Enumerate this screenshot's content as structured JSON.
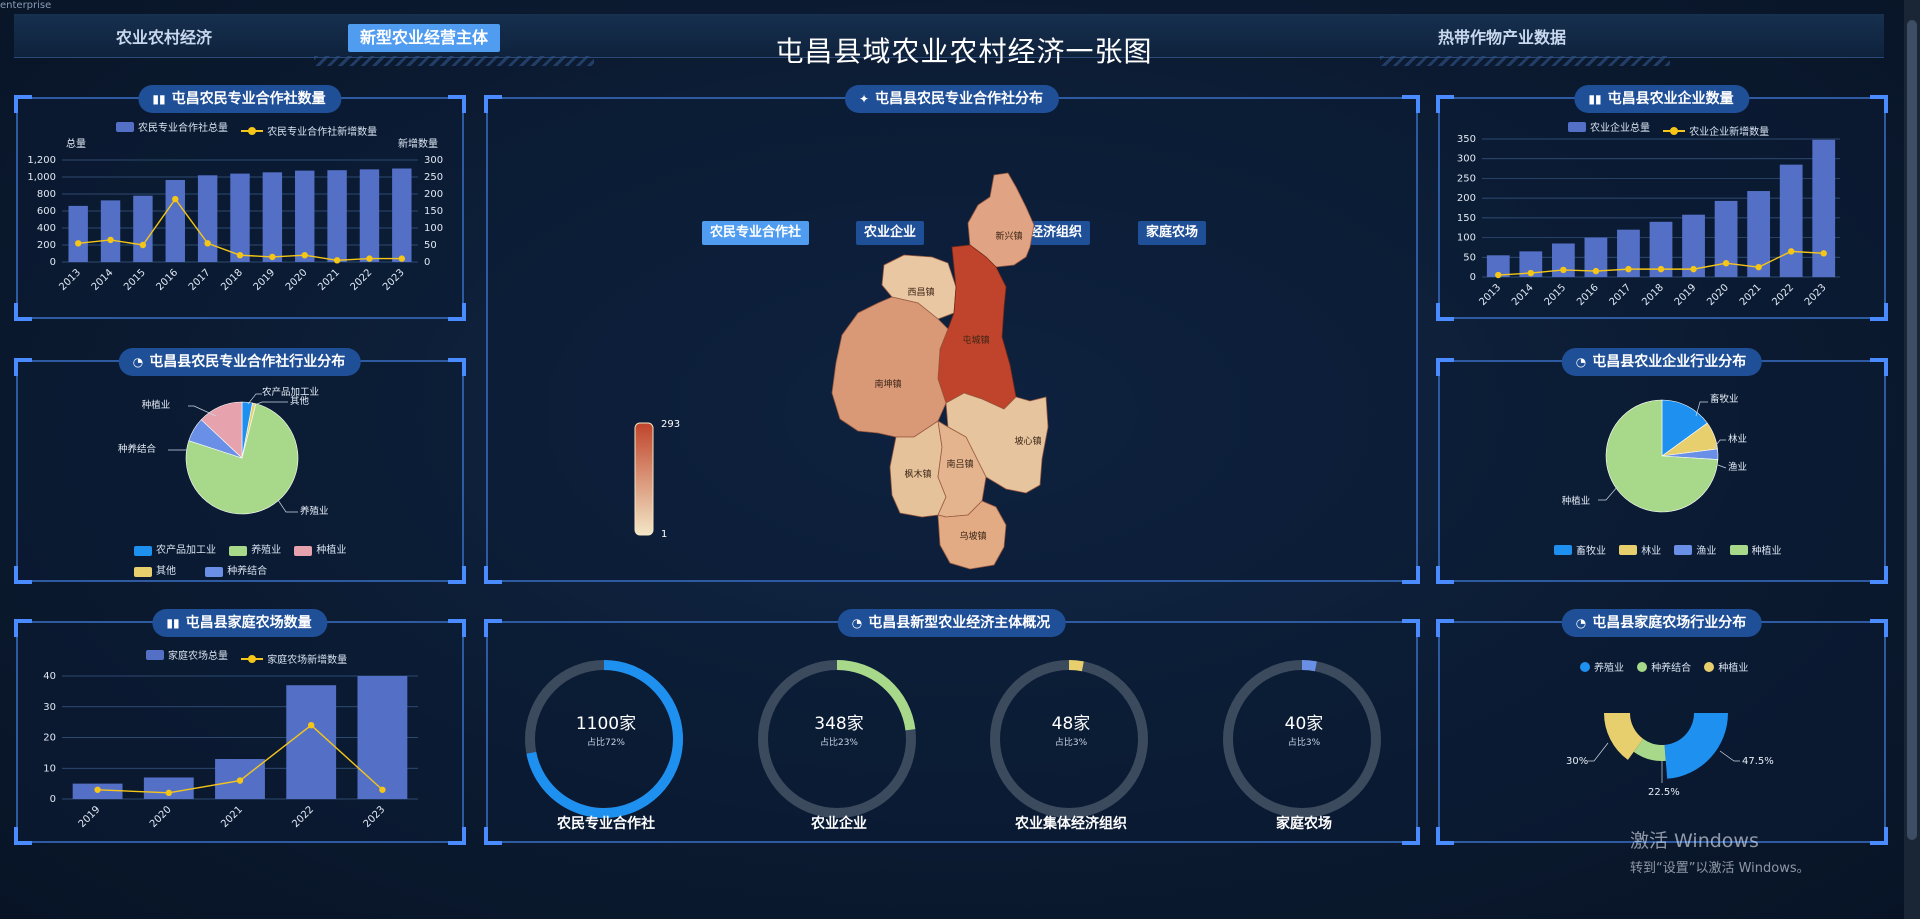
{
  "corner_text": "enterprise",
  "header": {
    "tabs": [
      {
        "label": "农业农村经济",
        "active": false
      },
      {
        "label": "新型农业经营主体",
        "active": true
      },
      {
        "label": "热带作物产业数据",
        "active": false
      }
    ],
    "title": "屯昌县域农业农村经济一张图"
  },
  "coop_count": {
    "title": "屯昌农民专业合作社数量",
    "legend_total": "农民专业合作社总量",
    "legend_new": "农民专业合作社新增数量",
    "ylabel_left": "总量",
    "ylabel_right": "新增数量",
    "left_ticks": [
      "1,200",
      "1,000",
      "800",
      "600",
      "400",
      "200",
      "0"
    ],
    "right_ticks": [
      "300",
      "250",
      "200",
      "150",
      "100",
      "50",
      "0"
    ]
  },
  "coop_industry": {
    "title": "屯昌县农民专业合作社行业分布",
    "labels": {
      "processing": "农产品加工业",
      "other": "其他",
      "planting": "种植业",
      "combo": "种养结合",
      "breeding": "养殖业"
    },
    "legend": [
      "农产品加工业",
      "养殖业",
      "种植业",
      "其他",
      "种养结合"
    ]
  },
  "family_farm_count": {
    "title": "屯昌县家庭农场数量",
    "legend_total": "家庭农场总量",
    "legend_new": "家庭农场新增数量",
    "ticks": [
      "40",
      "30",
      "20",
      "10",
      "0"
    ]
  },
  "map": {
    "title": "屯昌县农民专业合作社分布",
    "tabs": [
      {
        "label": "农民专业合作社",
        "active": true
      },
      {
        "label": "农业企业",
        "active": false
      },
      {
        "label": "农村集体经济组织",
        "active": false
      },
      {
        "label": "家庭农场",
        "active": false
      }
    ],
    "scale_max": "293",
    "scale_min": "1",
    "towns": [
      "新兴镇",
      "西昌镇",
      "屯城镇",
      "南坤镇",
      "坡心镇",
      "枫木镇",
      "南吕镇",
      "乌坡镇"
    ]
  },
  "overview": {
    "title": "屯昌县新型农业经济主体概况",
    "rings": [
      {
        "value": "1100家",
        "ratio": "占比72%",
        "name": "农民专业合作社",
        "pct": 72,
        "color": "#1e90f0"
      },
      {
        "value": "348家",
        "ratio": "占比23%",
        "name": "农业企业",
        "pct": 23,
        "color": "#a8d98a"
      },
      {
        "value": "48家",
        "ratio": "占比3%",
        "name": "农业集体经济组织",
        "pct": 3,
        "color": "#e8cf6e"
      },
      {
        "value": "40家",
        "ratio": "占比3%",
        "name": "家庭农场",
        "pct": 3,
        "color": "#6a8fe6"
      }
    ]
  },
  "enterprise_count": {
    "title": "屯昌县农业企业数量",
    "legend_total": "农业企业总量",
    "legend_new": "农业企业新增数量",
    "ticks": [
      "350",
      "300",
      "250",
      "200",
      "150",
      "100",
      "50",
      "0"
    ]
  },
  "enterprise_industry": {
    "title": "屯昌县农业企业行业分布",
    "labels": {
      "livestock": "畜牧业",
      "forestry": "林业",
      "fishery": "渔业",
      "planting": "种植业"
    },
    "legend": [
      "畜牧业",
      "林业",
      "渔业",
      "种植业"
    ]
  },
  "farm_industry": {
    "title": "屯昌县家庭农场行业分布",
    "legend": [
      "养殖业",
      "种养结合",
      "种植业"
    ],
    "labels": {
      "breeding_pct": "47.5%",
      "combo_pct": "22.5%",
      "planting_pct": "30%"
    }
  },
  "watermark": {
    "line1": "激活 Windows",
    "line2": "转到“设置”以激活 Windows。"
  },
  "chart_data": [
    {
      "type": "bar",
      "title": "屯昌农民专业合作社数量",
      "categories": [
        "2013",
        "2014",
        "2015",
        "2016",
        "2017",
        "2018",
        "2019",
        "2020",
        "2021",
        "2022",
        "2023"
      ],
      "ylim": [
        0,
        1200
      ],
      "y2lim": [
        0,
        300
      ],
      "series": [
        {
          "name": "农民专业合作社总量",
          "type": "bar",
          "values": [
            660,
            725,
            780,
            965,
            1020,
            1040,
            1055,
            1075,
            1080,
            1090,
            1100
          ]
        },
        {
          "name": "农民专业合作社新增数量",
          "type": "line",
          "axis": "right",
          "values": [
            55,
            65,
            50,
            185,
            55,
            20,
            15,
            20,
            5,
            10,
            10
          ]
        }
      ]
    },
    {
      "type": "pie",
      "title": "屯昌县农民专业合作社行业分布",
      "labels": [
        "农产品加工业",
        "其他",
        "养殖业",
        "种养结合",
        "种植业"
      ],
      "values": [
        3,
        1,
        76,
        7,
        13
      ]
    },
    {
      "type": "bar",
      "title": "屯昌县家庭农场数量",
      "categories": [
        "2019",
        "2020",
        "2021",
        "2022",
        "2023"
      ],
      "ylim": [
        0,
        40
      ],
      "series": [
        {
          "name": "家庭农场总量",
          "type": "bar",
          "values": [
            5,
            7,
            13,
            37,
            40
          ]
        },
        {
          "name": "家庭农场新增数量",
          "type": "line",
          "values": [
            3,
            2,
            6,
            24,
            3
          ]
        }
      ]
    },
    {
      "type": "bar",
      "title": "屯昌县农业企业数量",
      "categories": [
        "2013",
        "2014",
        "2015",
        "2016",
        "2017",
        "2018",
        "2019",
        "2020",
        "2021",
        "2022",
        "2023"
      ],
      "ylim": [
        0,
        350
      ],
      "series": [
        {
          "name": "农业企业总量",
          "type": "bar",
          "values": [
            55,
            65,
            85,
            100,
            120,
            140,
            158,
            193,
            218,
            285,
            348
          ]
        },
        {
          "name": "农业企业新增数量",
          "type": "line",
          "values": [
            5,
            10,
            18,
            15,
            20,
            20,
            20,
            35,
            25,
            65,
            60
          ]
        }
      ]
    },
    {
      "type": "pie",
      "title": "屯昌县农业企业行业分布",
      "labels": [
        "畜牧业",
        "林业",
        "渔业",
        "种植业"
      ],
      "values": [
        15,
        8,
        3,
        74
      ]
    },
    {
      "type": "pie",
      "title": "屯昌县家庭农场行业分布",
      "labels": [
        "养殖业",
        "种养结合",
        "种植业"
      ],
      "values": [
        47.5,
        22.5,
        30
      ]
    }
  ]
}
